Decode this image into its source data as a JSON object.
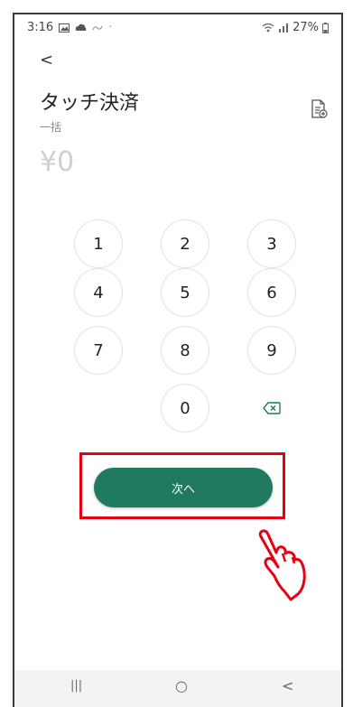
{
  "status_bar": {
    "time": "3:16",
    "battery": "27%",
    "icons": [
      "gallery-icon",
      "cloud-icon",
      "notification-icon",
      "wifi-icon",
      "signal-icon",
      "battery-icon"
    ]
  },
  "header": {
    "back": "<",
    "title": "タッチ決済",
    "subtitle": "一括"
  },
  "amount": "¥0",
  "keypad": {
    "k1": "1",
    "k2": "2",
    "k3": "3",
    "k4": "4",
    "k5": "5",
    "k6": "6",
    "k7": "7",
    "k8": "8",
    "k9": "9",
    "k0": "0"
  },
  "next_button": {
    "label": "次へ"
  },
  "nav_bar": {
    "recents": "|||",
    "home": "○",
    "back": "<"
  },
  "colors": {
    "primary": "#1f7a60",
    "highlight": "#e50012",
    "hand": "#e50012"
  }
}
